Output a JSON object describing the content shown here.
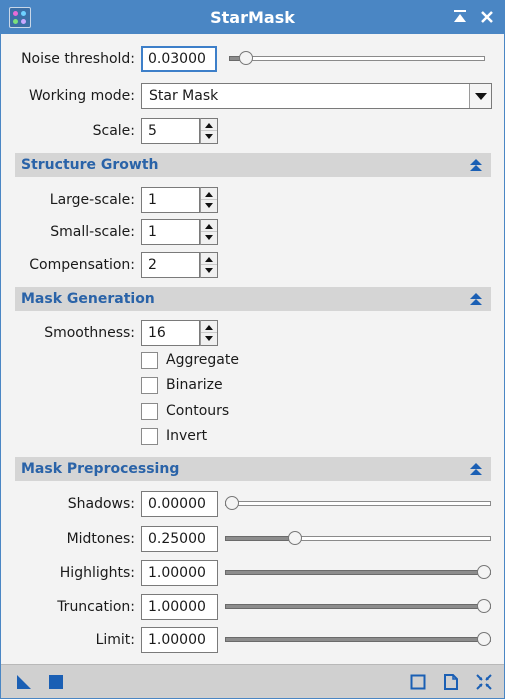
{
  "window": {
    "title": "StarMask"
  },
  "general": {
    "noise_threshold": {
      "label": "Noise threshold:",
      "value": "0.03000",
      "slider_fraction": 0.04
    },
    "working_mode": {
      "label": "Working mode:",
      "value": "Star Mask"
    },
    "scale": {
      "label": "Scale:",
      "value": "5"
    }
  },
  "structure_growth": {
    "title": "Structure Growth",
    "large_scale": {
      "label": "Large-scale:",
      "value": "1"
    },
    "small_scale": {
      "label": "Small-scale:",
      "value": "1"
    },
    "compensation": {
      "label": "Compensation:",
      "value": "2"
    }
  },
  "mask_generation": {
    "title": "Mask Generation",
    "smoothness": {
      "label": "Smoothness:",
      "value": "16"
    },
    "aggregate": {
      "label": "Aggregate",
      "checked": false
    },
    "binarize": {
      "label": "Binarize",
      "checked": false
    },
    "contours": {
      "label": "Contours",
      "checked": false
    },
    "invert": {
      "label": "Invert",
      "checked": false
    }
  },
  "mask_preprocessing": {
    "title": "Mask Preprocessing",
    "shadows": {
      "label": "Shadows:",
      "value": "0.00000",
      "slider_fraction": 0.0
    },
    "midtones": {
      "label": "Midtones:",
      "value": "0.25000",
      "slider_fraction": 0.25
    },
    "highlights": {
      "label": "Highlights:",
      "value": "1.00000",
      "slider_fraction": 1.0
    },
    "truncation": {
      "label": "Truncation:",
      "value": "1.00000",
      "slider_fraction": 1.0
    },
    "limit": {
      "label": "Limit:",
      "value": "1.00000",
      "slider_fraction": 1.0
    }
  },
  "colors": {
    "titlebar": "#4a86c4",
    "section_text": "#2a63a8",
    "icon_blue": "#1a5fb4"
  },
  "icons": {
    "app": "starmask-app-icon",
    "titlebar": [
      "shade-icon",
      "close-icon"
    ],
    "bottom_left": [
      "new-instance-icon",
      "apply-global-icon"
    ],
    "bottom_right": [
      "preview-icon",
      "documentation-icon",
      "reset-icon"
    ]
  }
}
